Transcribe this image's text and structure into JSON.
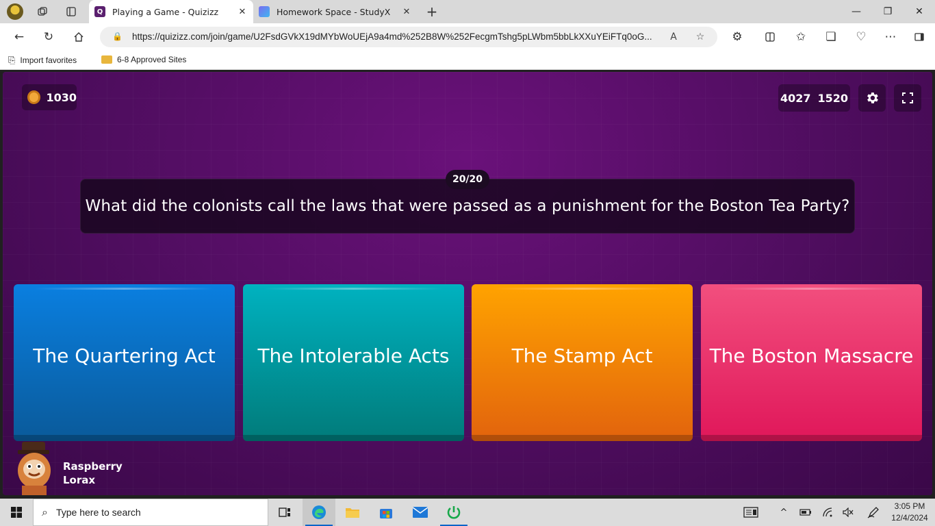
{
  "browser": {
    "tabs": [
      {
        "title": "Playing a Game - Quizizz",
        "active": true
      },
      {
        "title": "Homework Space - StudyX",
        "active": false
      }
    ],
    "url": "https://quizizz.com/join/game/U2FsdGVkX19dMYbWoUEjA9a4md%252B8W%252FecgmTshg5pLWbm5bbLkXXuYEiFTq0oG...",
    "favorites": [
      {
        "label": "Import favorites"
      },
      {
        "label": "6-8 Approved Sites"
      }
    ]
  },
  "game": {
    "coins": "1030",
    "score_a": "4027",
    "score_b": "1520",
    "question_counter": "20/20",
    "question": "What did the colonists call the laws that were passed as a punishment for the Boston Tea Party?",
    "answers": [
      {
        "label": "The Quartering Act",
        "color": "#0a7fe0"
      },
      {
        "label": "The Intolerable Acts",
        "color": "#00b2c0"
      },
      {
        "label": "The Stamp Act",
        "color": "#ffa300"
      },
      {
        "label": "The Boston Massacre",
        "color": "#f24f7e"
      }
    ],
    "player": {
      "name_line1": "Raspberry",
      "name_line2": "Lorax"
    }
  },
  "taskbar": {
    "search_placeholder": "Type here to search",
    "time": "3:05 PM",
    "date": "12/4/2024"
  }
}
